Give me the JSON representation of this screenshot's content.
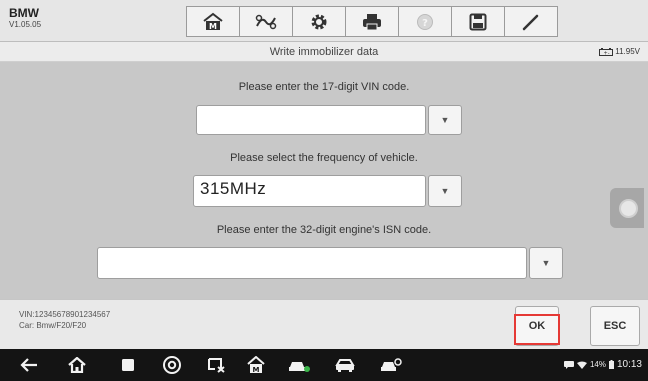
{
  "app": {
    "name": "BMW",
    "version": "V1.05.05"
  },
  "toolbar": {
    "icons": [
      "home-m-icon",
      "vci-icon",
      "settings-icon",
      "print-icon",
      "help-icon",
      "save-icon",
      "edit-icon"
    ]
  },
  "titlebar": {
    "title": "Write immobilizer data",
    "battery": "11.95V"
  },
  "form": {
    "vin_prompt": "Please enter the 17-digit VIN code.",
    "vin_value": "",
    "frequency_prompt": "Please select the frequency of vehicle.",
    "frequency_value": "315MHz",
    "isn_prompt": "Please enter the 32-digit engine's ISN code.",
    "isn_value": "",
    "dropdown_glyph": "▼"
  },
  "footer": {
    "vin_text": "VIN:12345678901234567",
    "car_text": "Car: Bmw/F20/F20",
    "ok_label": "OK",
    "esc_label": "ESC"
  },
  "status_bar": {
    "battery_percent": "14%",
    "time": "10:13"
  },
  "colors": {
    "highlight": "#e53935",
    "nav_bar": "#141414"
  }
}
